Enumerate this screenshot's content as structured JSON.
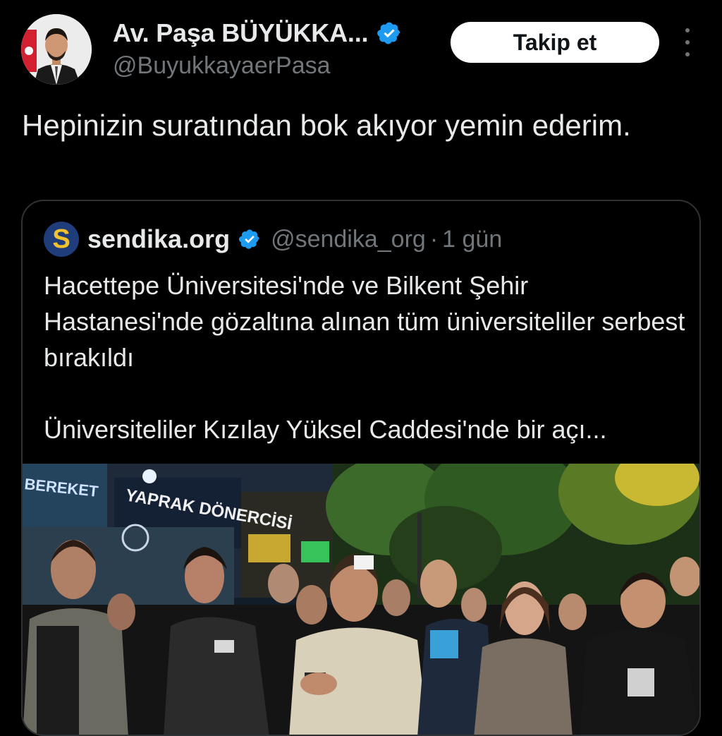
{
  "tweet": {
    "author_name": "Av. Paşa BÜYÜKKA...",
    "author_handle": "@BuyukkayaerPasa",
    "follow_label": "Takip et",
    "text": "Hepinizin suratından bok akıyor yemin ederim."
  },
  "quote": {
    "logo_letter": "S",
    "name": "sendika.org",
    "handle": "@sendika_org",
    "separator": "·",
    "time": "1 gün",
    "paragraph1": "Hacettepe Üniversitesi'nde ve Bilkent Şehir Hastanesi'nde gözaltına alınan tüm üniversiteliler serbest bırakıldı",
    "paragraph2": "Üniversiteliler Kızılay Yüksel Caddesi'nde bir açı...",
    "media": {
      "sign_text": "YAPRAK DÖNERCİSİ",
      "sign_text_left": "BEREKET"
    }
  },
  "colors": {
    "background": "#000000",
    "verified_blue": "#1d9bf0",
    "secondary_text": "#71767b",
    "border": "#2f3336"
  }
}
